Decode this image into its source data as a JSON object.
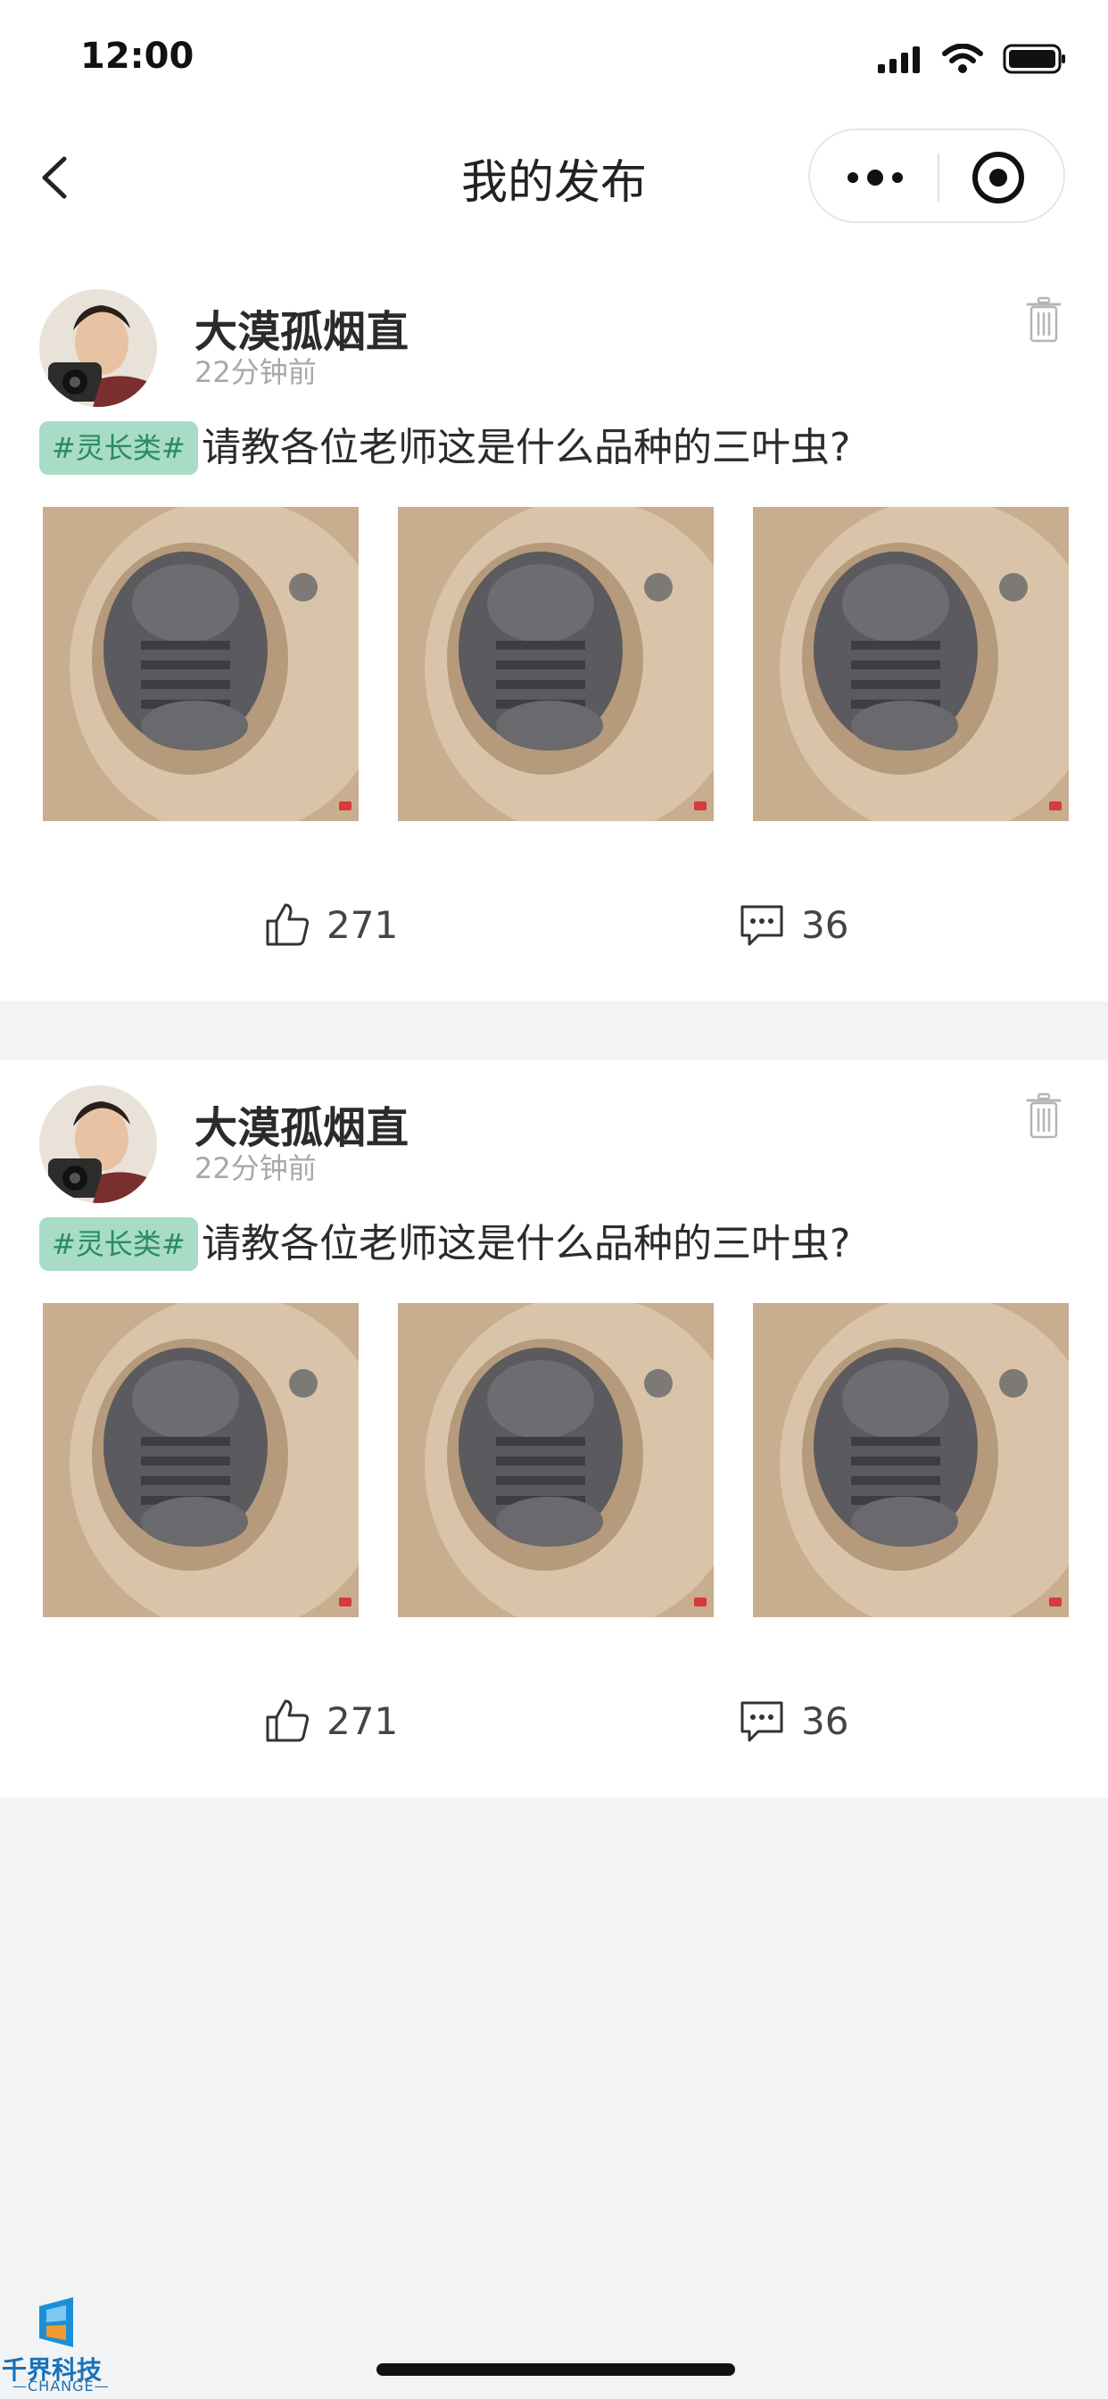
{
  "status_bar": {
    "time": "12:00"
  },
  "nav": {
    "title": "我的发布"
  },
  "posts": [
    {
      "username": "大漠孤烟直",
      "time": "22分钟前",
      "tag": "#灵长类#",
      "content": "请教各位老师这是什么品种的三叶虫?",
      "likes": "271",
      "comments": "36"
    },
    {
      "username": "大漠孤烟直",
      "time": "22分钟前",
      "tag": "#灵长类#",
      "content": "请教各位老师这是什么品种的三叶虫?",
      "likes": "271",
      "comments": "36"
    }
  ],
  "watermark": {
    "brand": "千界科技",
    "sub": "—CHANGE—"
  },
  "colors": {
    "tag_bg": "#a8dcc7",
    "tag_text": "#2a8a64",
    "background": "#f2f3f5"
  }
}
